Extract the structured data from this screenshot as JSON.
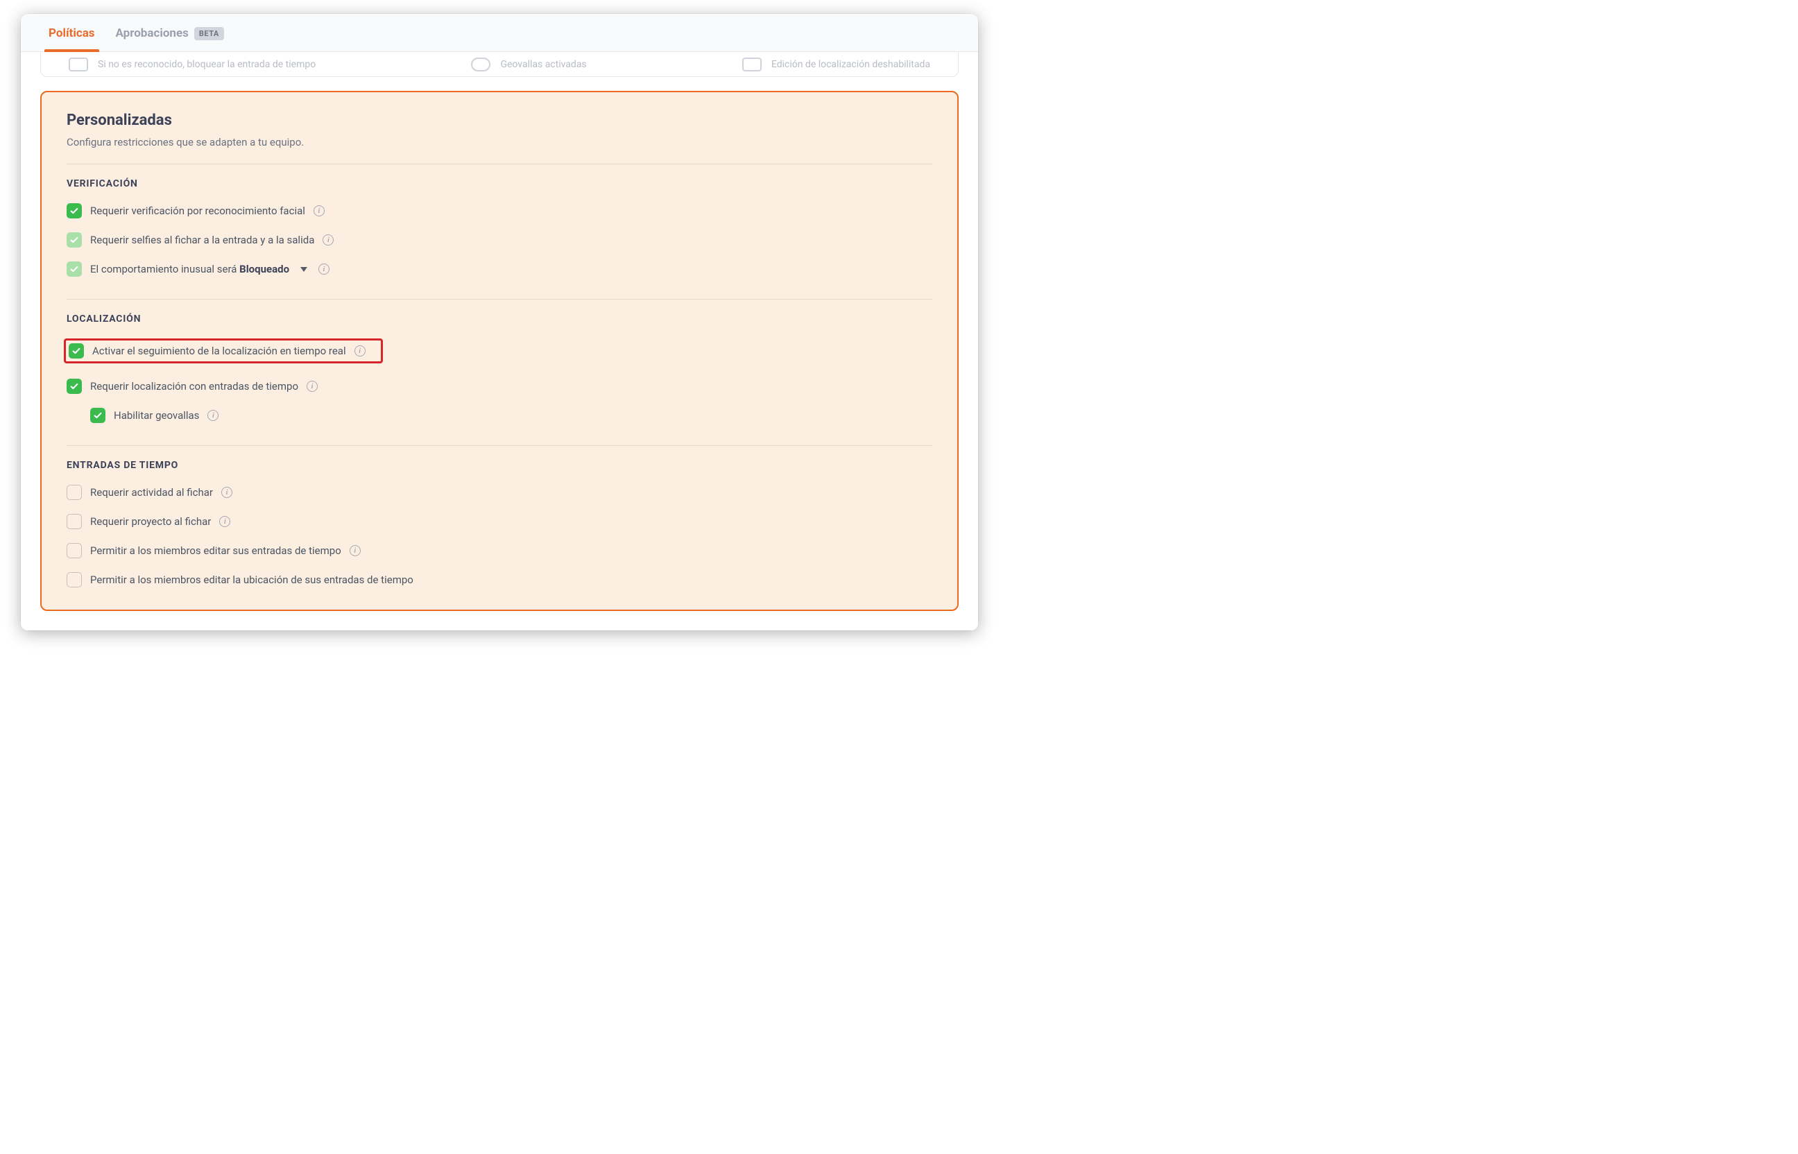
{
  "tabs": {
    "policies": "Políticas",
    "approvals": "Aprobaciones",
    "beta": "BETA"
  },
  "cutoff": {
    "a": "Si no es reconocido, bloquear la entrada de tiempo",
    "b": "Geovallas activadas",
    "c": "Edición de localización deshabilitada"
  },
  "panel": {
    "title": "Personalizadas",
    "subtitle": "Configura restricciones que se adapten a tu equipo."
  },
  "sections": {
    "verification": {
      "head": "VERIFICACIÓN",
      "opt1": "Requerir verificación por reconocimiento facial",
      "opt2": "Requerir selfies al fichar a la entrada y a la salida",
      "opt3_pre": "El comportamiento inusual será ",
      "opt3_bold": "Bloqueado"
    },
    "location": {
      "head": "LOCALIZACIÓN",
      "opt1": "Activar el seguimiento de la localización en tiempo real",
      "opt2": "Requerir localización con entradas de tiempo",
      "opt3": "Habilitar geovallas"
    },
    "time": {
      "head": "ENTRADAS DE TIEMPO",
      "opt1": "Requerir actividad al fichar",
      "opt2": "Requerir proyecto al fichar",
      "opt3": "Permitir a los miembros editar sus entradas de tiempo",
      "opt4": "Permitir a los miembros editar la ubicación de sus entradas de tiempo"
    }
  }
}
